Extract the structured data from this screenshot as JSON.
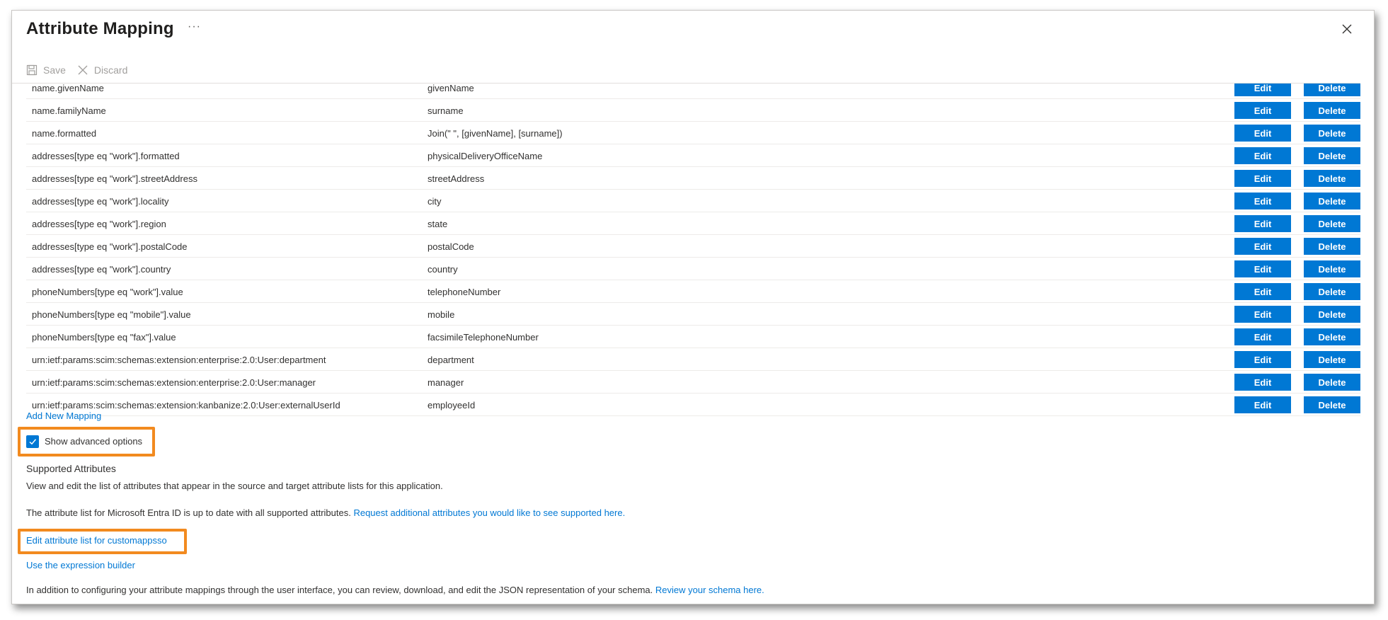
{
  "header": {
    "title": "Attribute Mapping",
    "more_label": "···"
  },
  "toolbar": {
    "save_label": "Save",
    "discard_label": "Discard"
  },
  "table": {
    "edit_label": "Edit",
    "delete_label": "Delete",
    "rows": [
      {
        "target": "name.givenName",
        "source": "givenName"
      },
      {
        "target": "name.familyName",
        "source": "surname"
      },
      {
        "target": "name.formatted",
        "source": "Join(\" \", [givenName], [surname])"
      },
      {
        "target": "addresses[type eq \"work\"].formatted",
        "source": "physicalDeliveryOfficeName"
      },
      {
        "target": "addresses[type eq \"work\"].streetAddress",
        "source": "streetAddress"
      },
      {
        "target": "addresses[type eq \"work\"].locality",
        "source": "city"
      },
      {
        "target": "addresses[type eq \"work\"].region",
        "source": "state"
      },
      {
        "target": "addresses[type eq \"work\"].postalCode",
        "source": "postalCode"
      },
      {
        "target": "addresses[type eq \"work\"].country",
        "source": "country"
      },
      {
        "target": "phoneNumbers[type eq \"work\"].value",
        "source": "telephoneNumber"
      },
      {
        "target": "phoneNumbers[type eq \"mobile\"].value",
        "source": "mobile"
      },
      {
        "target": "phoneNumbers[type eq \"fax\"].value",
        "source": "facsimileTelephoneNumber"
      },
      {
        "target": "urn:ietf:params:scim:schemas:extension:enterprise:2.0:User:department",
        "source": "department"
      },
      {
        "target": "urn:ietf:params:scim:schemas:extension:enterprise:2.0:User:manager",
        "source": "manager"
      },
      {
        "target": "urn:ietf:params:scim:schemas:extension:kanbanize:2.0:User:externalUserId",
        "source": "employeeId"
      }
    ]
  },
  "add_mapping_label": "Add New Mapping",
  "advanced": {
    "checked": true,
    "label": "Show advanced options"
  },
  "supported": {
    "title": "Supported Attributes",
    "description": "View and edit the list of attributes that appear in the source and target attribute lists for this application.",
    "status_text": "The attribute list for Microsoft Entra ID is up to date with all supported attributes.",
    "request_link": "Request additional attributes you would like to see supported here.",
    "edit_list_link": "Edit attribute list for customappsso",
    "expression_builder_link": "Use the expression builder",
    "schema_text": "In addition to configuring your attribute mappings through the user interface, you can review, download, and edit the JSON representation of your schema.",
    "schema_link": "Review your schema here."
  },
  "colors": {
    "accent": "#0078d4",
    "highlight": "#f28a1f"
  }
}
